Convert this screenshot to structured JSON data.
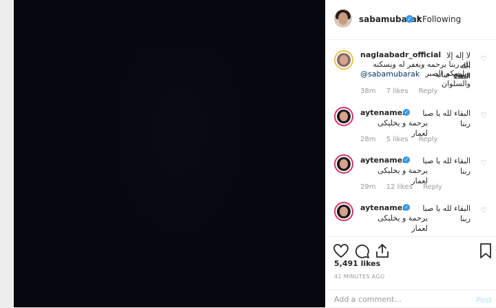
{
  "post": {
    "author": "sabamubarak",
    "separator": "•",
    "follow_status": "Following",
    "likes": "5,491 likes",
    "time_ago": "41 MINUTES AGO"
  },
  "comments": [
    {
      "user": "naglaabadr_official",
      "text_line1": "لا إله إلا الله البقاء",
      "text_line2": "لله ربنا يرحمه ويغفر له ويسكنه فسيح جناته",
      "mention": "@sabamubarak",
      "text_line3": "ويلهمكم الصبر والسلوان",
      "time": "38m",
      "likes": "7 likes",
      "reply": "Reply"
    },
    {
      "user": "aytenamer",
      "text_line1": "البقاء لله يا صبا ربنا",
      "text_line2": "يرحمة و يخليكى لعمار",
      "time": "28m",
      "likes": "5 likes",
      "reply": "Reply"
    },
    {
      "user": "aytenamer",
      "text_line1": "البقاء لله يا صبا ربنا",
      "text_line2": "يرحمة و يخليكى لعمار",
      "time": "29m",
      "likes": "12 likes",
      "reply": "Reply"
    },
    {
      "user": "aytenamer",
      "text_line1": "البقاء لله يا صبا ربنا",
      "text_line2": "يرحمة و يخليكى لعمار",
      "time": "",
      "likes": "",
      "reply": ""
    }
  ],
  "add_comment": {
    "placeholder": "Add a comment...",
    "post_label": "Post"
  },
  "icons": {
    "verified": "verified-badge-icon",
    "heart": "heart-icon",
    "comment": "comment-icon",
    "share": "share-icon",
    "bookmark": "bookmark-icon"
  },
  "colors": {
    "verified": "#3897f0",
    "post_button_disabled": "#b2dffc",
    "media_background": "#07070f"
  }
}
